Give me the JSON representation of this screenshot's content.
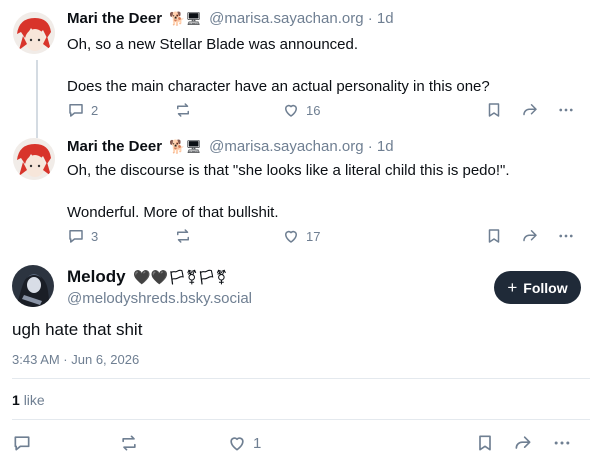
{
  "replies": [
    {
      "author": "Mari the Deer",
      "badges": "🐕🖥",
      "handle": "@marisa.sayachan.org",
      "separator": "·",
      "time": "1d",
      "lines": [
        "Oh, so a new Stellar Blade was announced.",
        "",
        "Does the main character have an actual personality in this one?"
      ],
      "reply_count": "2",
      "like_count": "16"
    },
    {
      "author": "Mari the Deer",
      "badges": "🐕🖥",
      "handle": "@marisa.sayachan.org",
      "separator": "·",
      "time": "1d",
      "lines": [
        "Oh, the discourse is that \"she looks like a literal child this is pedo!\".",
        "",
        "Wonderful. More of that bullshit."
      ],
      "reply_count": "3",
      "like_count": "17"
    }
  ],
  "main_post": {
    "author": "Melody",
    "badges": "🖤🖤🏳⚧🏳⚧",
    "handle": "@melodyshreds.bsky.social",
    "follow_label": "Follow",
    "follow_icon": "+",
    "text": "ugh hate that shit",
    "timestamp": "3:43 AM · Jun 6, 2026",
    "like_count": "1",
    "like_label": "like",
    "footer_like_count": "1"
  },
  "icons": {
    "reply": "reply-icon",
    "repost": "repost-icon",
    "like": "heart-icon",
    "bookmark": "bookmark-icon",
    "share": "share-icon",
    "more": "more-icon"
  },
  "colors": {
    "text": "#0b0f14",
    "muted": "#6f7f92",
    "follow_bg": "#1f2a38",
    "thread_line": "#d4dbe2"
  }
}
